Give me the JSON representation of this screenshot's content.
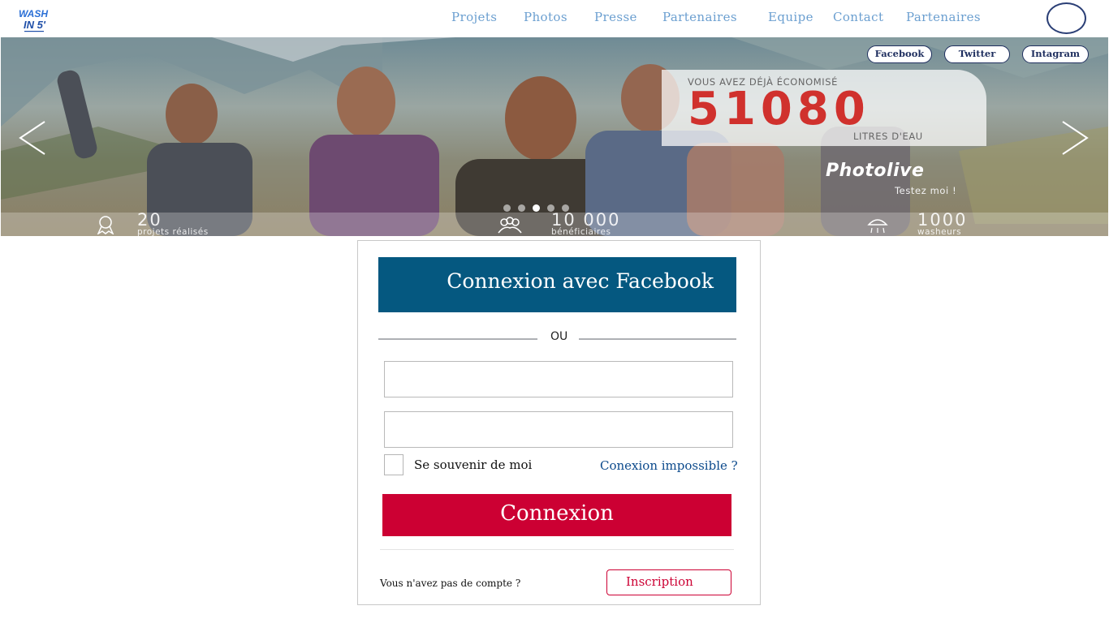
{
  "brand": {
    "logo_top": "WASH",
    "logo_bottom": "IN 5'",
    "logo_icon": "wash-in-5-logo"
  },
  "nav": {
    "items": [
      {
        "label": "Projets"
      },
      {
        "label": "Photos"
      },
      {
        "label": "Presse"
      },
      {
        "label": "Partenaires"
      },
      {
        "label": "Equipe"
      },
      {
        "label": "Contact"
      },
      {
        "label": "Partenaires"
      }
    ],
    "profile_icon": "circle-outline-icon"
  },
  "hero": {
    "social": [
      {
        "label": "Facebook"
      },
      {
        "label": "Twitter"
      },
      {
        "label": "Intagram"
      }
    ],
    "counter": {
      "prefix": "VOUS AVEZ DÉJÀ ÉCONOMISÉ",
      "value": "51080",
      "unit": "LITRES D'EAU"
    },
    "promo": {
      "title": "Photolive",
      "subtitle": "Testez moi !"
    },
    "slides": {
      "count": 5,
      "active": 2
    },
    "stats": [
      {
        "value": "20",
        "label": "projets réalisés",
        "icon": "award-ribbon-icon"
      },
      {
        "value": "10 000",
        "label": "bénéficiaires",
        "icon": "people-group-icon"
      },
      {
        "value": "1000",
        "label": "washeurs",
        "icon": "shower-icon"
      }
    ],
    "colors": {
      "counter": "#d0312d"
    }
  },
  "login": {
    "facebook_label": "Connexion avec Facebook",
    "separator": "OU",
    "username": {
      "value": "",
      "placeholder": ""
    },
    "password": {
      "value": "",
      "placeholder": ""
    },
    "remember_label": "Se souvenir de moi",
    "remember_checked": false,
    "forgot_label": "Conexion impossible ?",
    "submit_label": "Connexion",
    "no_account_label": "Vous n'avez pas de compte ?",
    "signup_label": "Inscription",
    "colors": {
      "facebook": "#055880",
      "primary": "#cc0033",
      "link": "#0c4a8c"
    }
  }
}
